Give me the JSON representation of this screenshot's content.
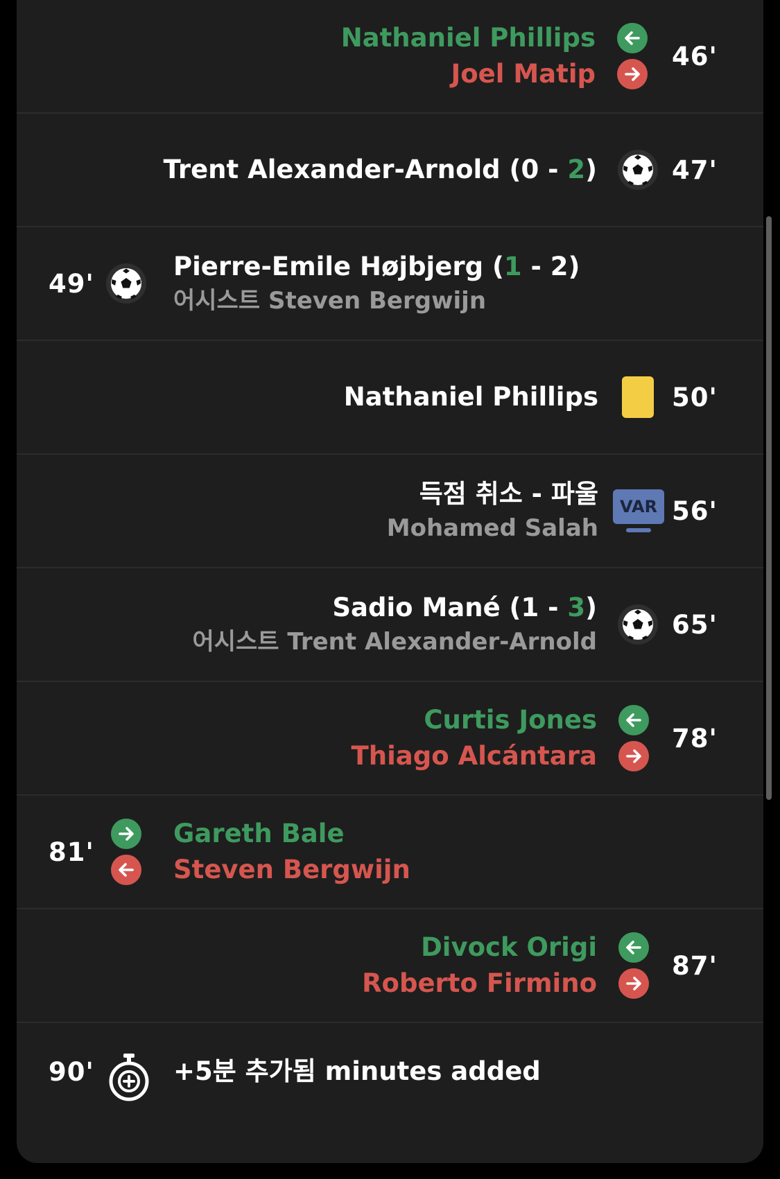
{
  "events": [
    {
      "minute": "46'",
      "in": "Nathaniel Phillips",
      "out": "Joel Matip"
    },
    {
      "minute": "47'",
      "player": "Trent Alexander-Arnold",
      "score_pre": " (0 - ",
      "score_hl": "2",
      "score_post": ")"
    },
    {
      "minute": "49'",
      "player": "Pierre-Emile Højbjerg",
      "score_pre": " (",
      "score_hl": "1",
      "score_post": " - 2)",
      "assist": "어시스트 Steven Bergwijn"
    },
    {
      "minute": "50'",
      "player": "Nathaniel Phillips"
    },
    {
      "minute": "56'",
      "title": "득점 취소 - 파울",
      "player": "Mohamed Salah",
      "var_label": "VAR"
    },
    {
      "minute": "65'",
      "player": "Sadio Mané",
      "score_pre": " (1 - ",
      "score_hl": "3",
      "score_post": ")",
      "assist": "어시스트 Trent Alexander-Arnold"
    },
    {
      "minute": "78'",
      "in": "Curtis Jones",
      "out": "Thiago Alcántara"
    },
    {
      "minute": "81'",
      "in": "Gareth Bale",
      "out": "Steven Bergwijn"
    },
    {
      "minute": "87'",
      "in": "Divock Origi",
      "out": "Roberto Firmino"
    },
    {
      "minute": "90'",
      "text": "+5분 추가됨 minutes added"
    }
  ],
  "colors": {
    "sub_in": "#3e9a5e",
    "sub_out": "#d6564f",
    "yellow_card": "#f3ce44",
    "var": "#5f79b5"
  },
  "icons": {
    "sub_in": "arrow-left-green-circle",
    "sub_out": "arrow-right-red-circle",
    "goal": "soccer-ball-icon",
    "card": "yellow-card-icon",
    "var": "var-monitor-icon",
    "added_time": "stopwatch-plus-icon"
  }
}
